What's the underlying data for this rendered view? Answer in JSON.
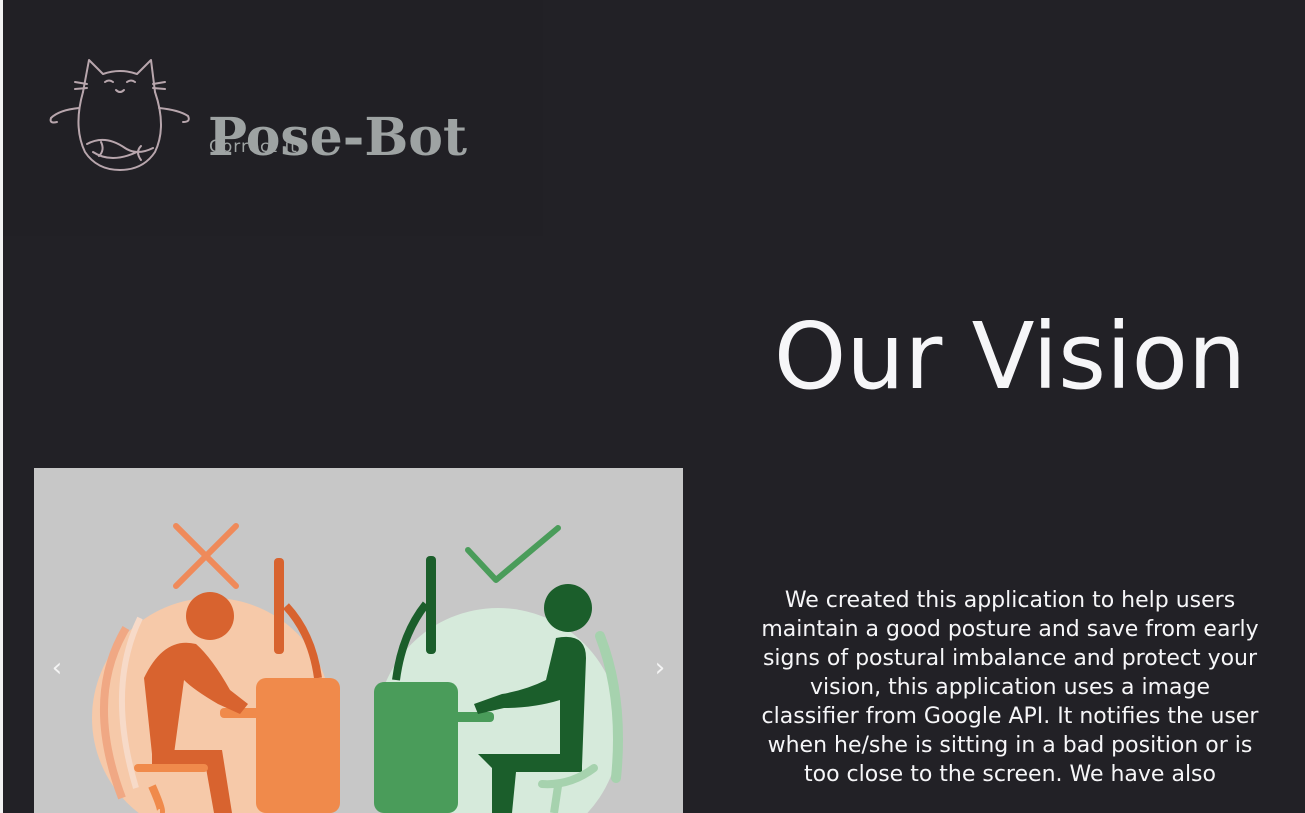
{
  "brand": {
    "name": "Pose-Bot",
    "tagline": "Correct it!"
  },
  "carousel": {
    "prev_icon": "chevron-left-icon",
    "next_icon": "chevron-right-icon",
    "prev_glyph": "‹",
    "next_glyph": "›",
    "slide": {
      "bad_posture_color": "#d8632f",
      "good_posture_color": "#1b5e2b",
      "background": "#c7c7c7"
    }
  },
  "vision": {
    "title": "Our Vision",
    "body": "We created this application to help users maintain a good posture and save from early signs of postural imbalance and protect your vision, this application uses a image classifier from Google API. It notifies the user when he/she is sitting in a bad position or is too close to the screen. We have also"
  },
  "colors": {
    "background": "#222126",
    "text": "#f6f6f8",
    "brand_text": "#9ea3a3"
  }
}
